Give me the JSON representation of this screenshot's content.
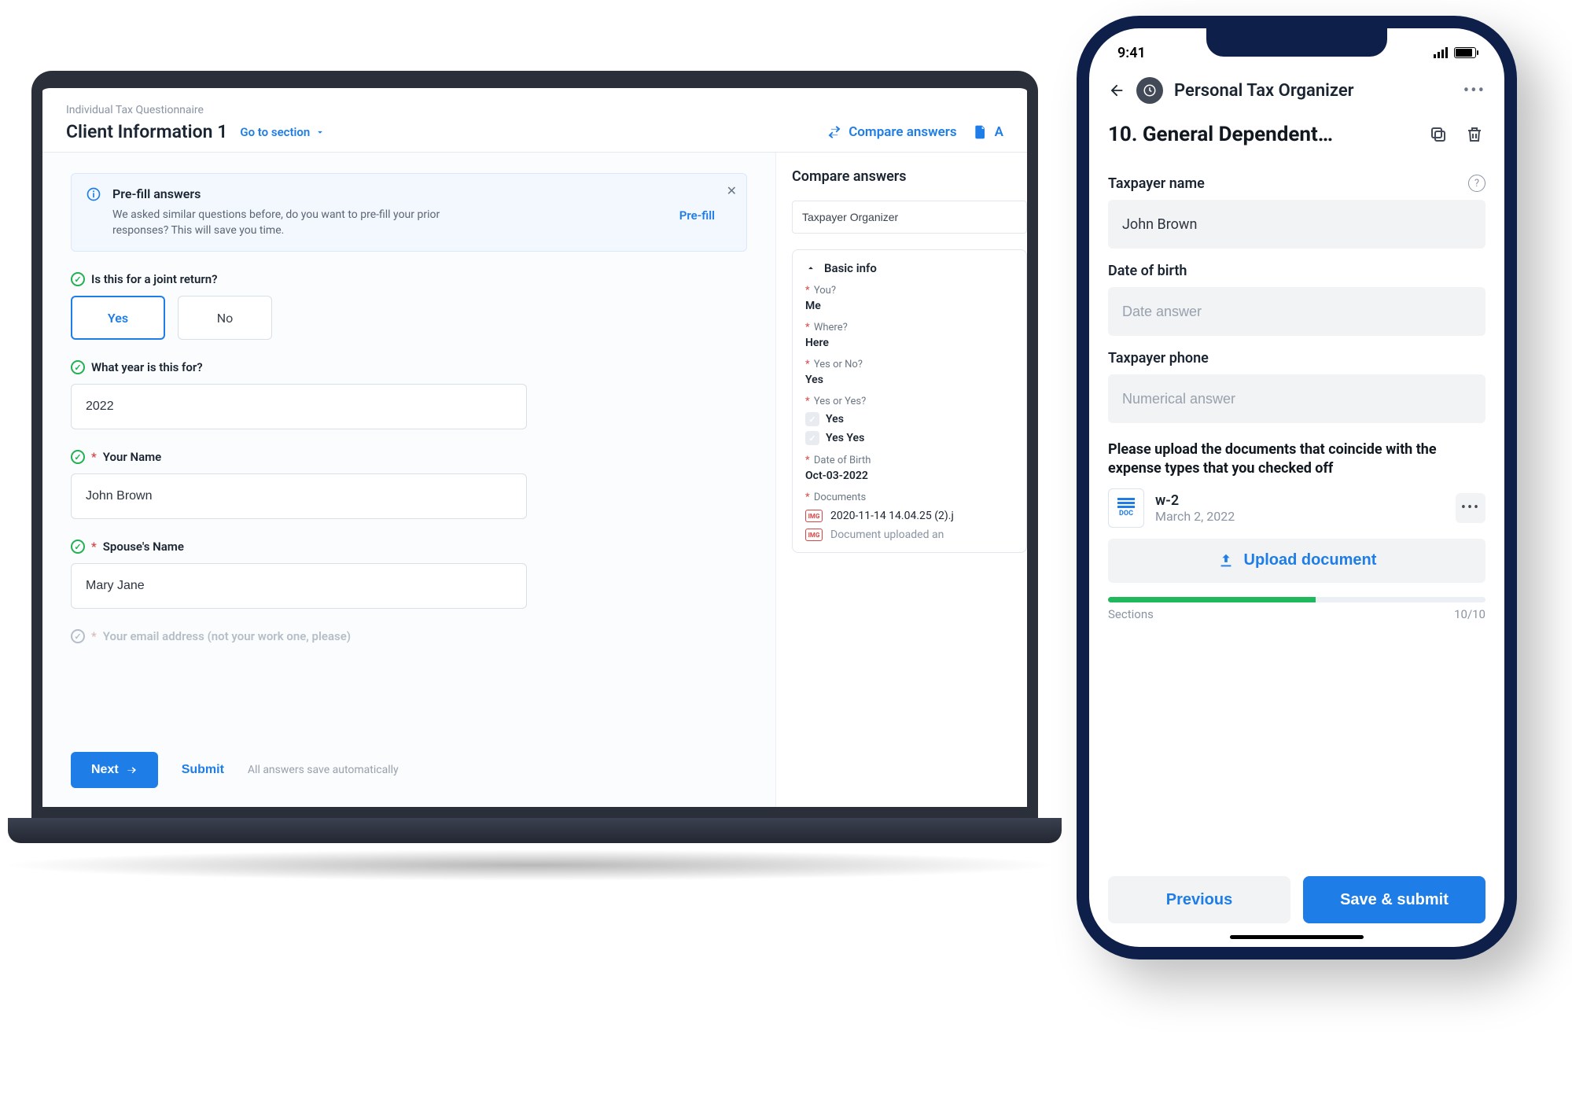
{
  "desktop": {
    "breadcrumb": "Individual Tax Questionnaire",
    "title": "Client Information 1",
    "goto_label": "Go to section",
    "header_actions": {
      "compare": "Compare answers",
      "second": "A"
    },
    "prefill": {
      "title": "Pre-fill answers",
      "desc": "We asked similar questions before, do you want to pre-fill your prior responses? This will save you time.",
      "link": "Pre-fill"
    },
    "q1": {
      "label": "Is this for a joint return?",
      "yes": "Yes",
      "no": "No"
    },
    "q2": {
      "label": "What year is this for?",
      "value": "2022"
    },
    "q3": {
      "label": "Your Name",
      "value": "John Brown"
    },
    "q4": {
      "label": "Spouse's Name",
      "value": "Mary Jane"
    },
    "q5_label": "Your email address (not your work one, please)",
    "footer": {
      "next": "Next",
      "submit": "Submit",
      "autosave": "All answers save automatically"
    },
    "side": {
      "heading": "Compare answers",
      "organizer": "Taxpayer Organizer",
      "accordion_title": "Basic info",
      "kv": {
        "you": {
          "k": "You?",
          "v": "Me"
        },
        "where": {
          "k": "Where?",
          "v": "Here"
        },
        "yesno": {
          "k": "Yes or No?",
          "v": "Yes"
        },
        "yesyes": {
          "k": "Yes or Yes?",
          "opt1": "Yes",
          "opt2": "Yes Yes"
        },
        "dob": {
          "k": "Date of Birth",
          "v": "Oct-03-2022"
        },
        "docs": {
          "k": "Documents",
          "file1": "2020-11-14 14.04.25 (2).j",
          "file2": "Document uploaded an"
        },
        "badge": "IMG"
      }
    }
  },
  "phone": {
    "status": {
      "time": "9:41"
    },
    "nav_title": "Personal Tax Organizer",
    "section_title": "10. General Dependent…",
    "fields": {
      "name": {
        "label": "Taxpayer name",
        "value": "John Brown"
      },
      "dob": {
        "label": "Date of birth",
        "placeholder": "Date answer"
      },
      "phone": {
        "label": "Taxpayer phone",
        "placeholder": "Numerical answer"
      }
    },
    "upload": {
      "title": "Please upload the documents that coincide with the expense types that you checked off",
      "doc_badge": "DOC",
      "file": {
        "name": "w-2",
        "date": "March 2, 2022"
      },
      "button": "Upload document"
    },
    "progress": {
      "label": "Sections",
      "value": "10/10"
    },
    "footer": {
      "prev": "Previous",
      "save": "Save & submit"
    }
  }
}
